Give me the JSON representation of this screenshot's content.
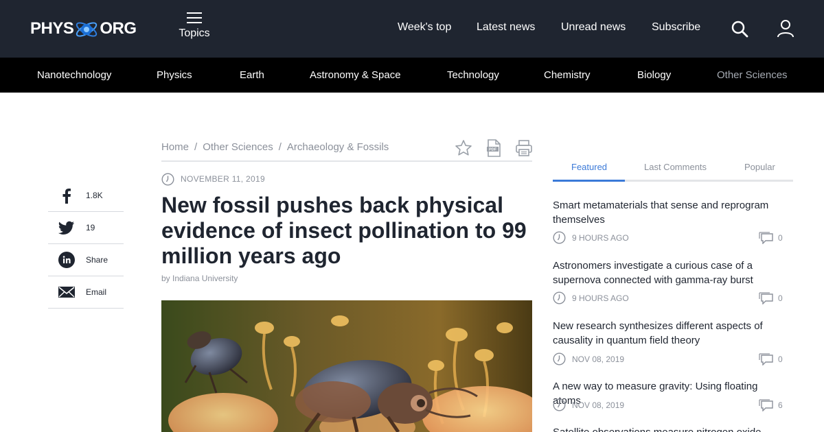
{
  "header": {
    "logo_left": "PHYS",
    "logo_right": "ORG",
    "topics_label": "Topics",
    "nav": [
      "Week's top",
      "Latest news",
      "Unread news",
      "Subscribe"
    ],
    "bg_color": "#1f2530"
  },
  "categories": [
    "Nanotechnology",
    "Physics",
    "Earth",
    "Astronomy & Space",
    "Technology",
    "Chemistry",
    "Biology",
    "Other Sciences"
  ],
  "share": [
    {
      "icon": "facebook-icon",
      "label": "1.8K"
    },
    {
      "icon": "twitter-icon",
      "label": "19"
    },
    {
      "icon": "linkedin-icon",
      "label": "Share"
    },
    {
      "icon": "email-icon",
      "label": "Email"
    }
  ],
  "article": {
    "breadcrumb": [
      "Home",
      "Other Sciences",
      "Archaeology & Fossils"
    ],
    "breadcrumb_sep": "/",
    "date": "NOVEMBER 11, 2019",
    "title": "New fossil pushes back physical evidence of insect pollination to 99 million years ago",
    "byline_prefix": "by",
    "byline_source": "Indiana University",
    "tools": [
      "bookmark-star-icon",
      "pdf-icon",
      "print-icon"
    ]
  },
  "sidebar": {
    "tabs": [
      "Featured",
      "Last Comments",
      "Popular"
    ],
    "active_tab": "Featured",
    "accent_color": "#3b7ad8",
    "items": [
      {
        "title": "Smart metamaterials that sense and reprogram themselves",
        "time": "9 HOURS AGO",
        "comments": "0"
      },
      {
        "title": "Astronomers investigate a curious case of a supernova connected with gamma-ray burst",
        "time": "9 HOURS AGO",
        "comments": "0"
      },
      {
        "title": "New research synthesizes different aspects of causality in quantum field theory",
        "time": "NOV 08, 2019",
        "comments": "0"
      },
      {
        "title": "A new way to measure gravity: Using floating atoms",
        "time": "NOV 08, 2019",
        "comments": "6"
      },
      {
        "title": "Satellite observations measure nitrogen oxide"
      }
    ]
  }
}
